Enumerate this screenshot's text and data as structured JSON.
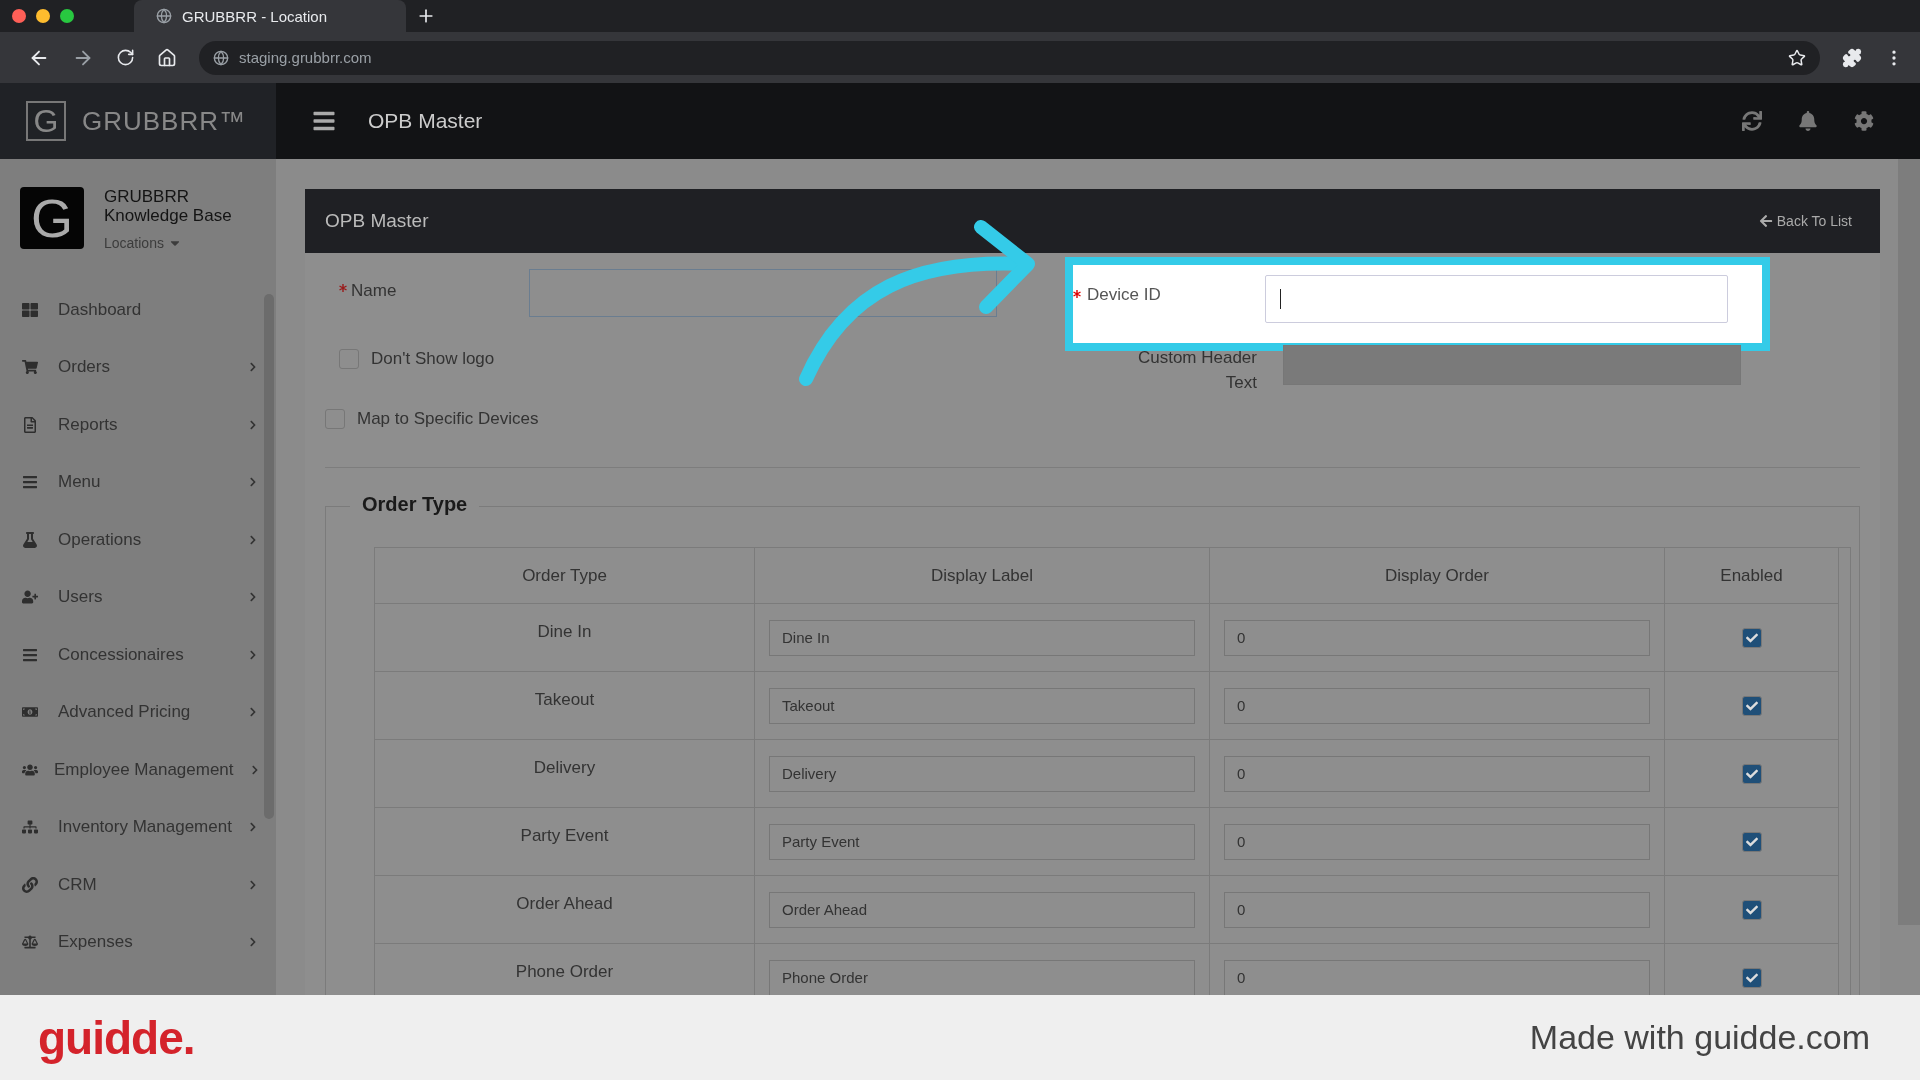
{
  "browser": {
    "tab_title": "GRUBBRR - Location",
    "url": "staging.grubbrr.com"
  },
  "app_header": {
    "logo_letter": "G",
    "brand": "GRUBBRR™",
    "page_title": "OPB Master"
  },
  "sidebar": {
    "org_logo_letter": "G",
    "org_name": "GRUBBRR Knowledge Base",
    "location_menu": "Locations",
    "items": [
      {
        "label": "Dashboard",
        "expandable": false
      },
      {
        "label": "Orders",
        "expandable": true
      },
      {
        "label": "Reports",
        "expandable": true
      },
      {
        "label": "Menu",
        "expandable": true
      },
      {
        "label": "Operations",
        "expandable": true
      },
      {
        "label": "Users",
        "expandable": true
      },
      {
        "label": "Concessionaires",
        "expandable": true
      },
      {
        "label": "Advanced Pricing",
        "expandable": true
      },
      {
        "label": "Employee Management",
        "expandable": true
      },
      {
        "label": "Inventory Management",
        "expandable": true
      },
      {
        "label": "CRM",
        "expandable": true
      },
      {
        "label": "Expenses",
        "expandable": true
      }
    ]
  },
  "panel": {
    "title": "OPB Master",
    "back_link": "Back To List"
  },
  "form": {
    "name": {
      "label": "Name",
      "required": true
    },
    "device_id": {
      "label": "Device ID",
      "required": true,
      "highlighted": true
    },
    "dont_show_logo": {
      "label": "Don't Show logo",
      "checked": false
    },
    "custom_header_text": {
      "label": "Custom Header Text",
      "disabled": true
    },
    "map_to_specific_devices": {
      "label": "Map to Specific Devices",
      "checked": false
    }
  },
  "order_type": {
    "title": "Order Type",
    "columns": [
      "Order Type",
      "Display Label",
      "Display Order",
      "Enabled"
    ],
    "rows": [
      {
        "order_type": "Dine In",
        "display_label": "Dine In",
        "display_order": "0",
        "enabled": true
      },
      {
        "order_type": "Takeout",
        "display_label": "Takeout",
        "display_order": "0",
        "enabled": true
      },
      {
        "order_type": "Delivery",
        "display_label": "Delivery",
        "display_order": "0",
        "enabled": true
      },
      {
        "order_type": "Party Event",
        "display_label": "Party Event",
        "display_order": "0",
        "enabled": true
      },
      {
        "order_type": "Order Ahead",
        "display_label": "Order Ahead",
        "display_order": "0",
        "enabled": true
      },
      {
        "order_type": "Phone Order",
        "display_label": "Phone Order",
        "display_order": "0",
        "enabled": true
      }
    ]
  },
  "footer": {
    "brand": "guidde.",
    "tagline": "Made with guidde.com"
  }
}
